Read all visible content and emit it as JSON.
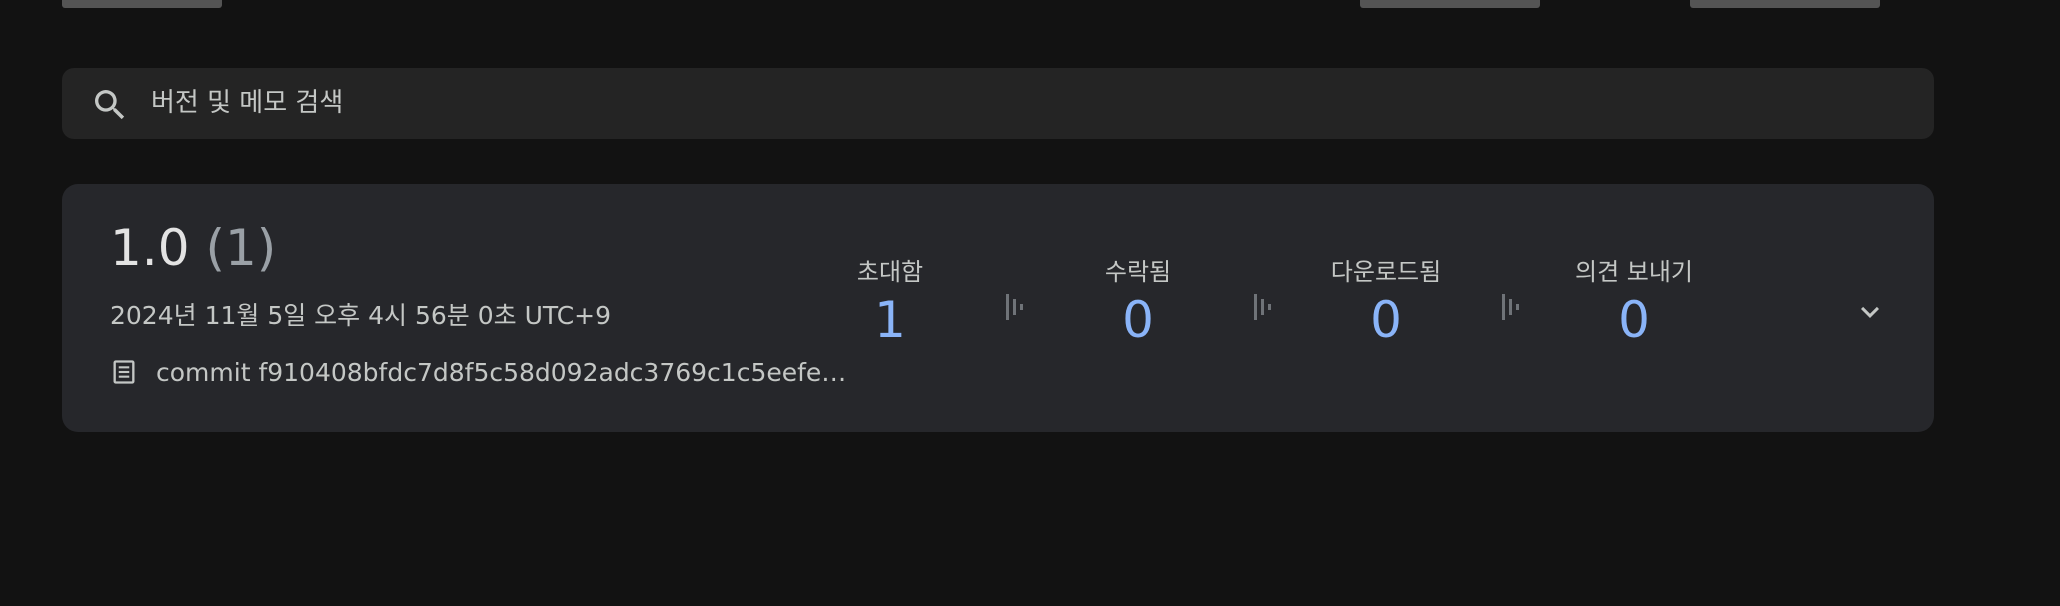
{
  "search": {
    "icon": "search-icon",
    "placeholder": "버전 및 메모 검색"
  },
  "release": {
    "version": "1.0",
    "build": "(1)",
    "date": "2024년 11월 5일 오후 4시 56분 0초 UTC+9",
    "notes_icon": "release-notes-icon",
    "notes": "commit f910408bfdc7d8f5c58d092adc3769c1c5eefe…",
    "stats": [
      {
        "label": "초대함",
        "value": "1"
      },
      {
        "label": "수락됨",
        "value": "0"
      },
      {
        "label": "다운로드됨",
        "value": "0"
      },
      {
        "label": "의견 보내기",
        "value": "0"
      }
    ],
    "expand_icon": "chevron-down-icon"
  },
  "colors": {
    "background": "#121212",
    "surface": "#26272b",
    "search_surface": "#242424",
    "accent": "#8ab4f8",
    "text_primary": "#e3e3e3",
    "text_secondary": "#c4c7c5"
  }
}
